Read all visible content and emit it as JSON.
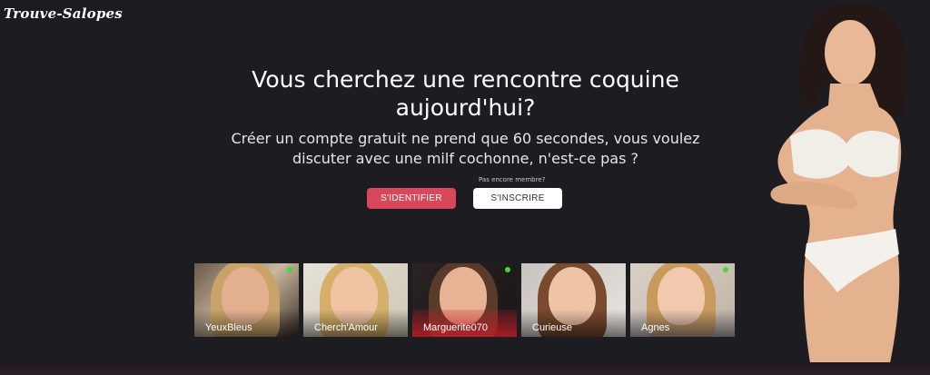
{
  "site": {
    "logo": "Trouve-Salopes"
  },
  "hero": {
    "headline": "Vous cherchez une rencontre coquine aujourd'hui?",
    "subline": "Créer un compte gratuit ne prend que 60 secondes, vous voulez discuter avec une milf cochonne, n'est-ce pas ?",
    "not_member": "Pas encore membre?",
    "login_label": "S'IDENTIFIER",
    "signup_label": "S'INSCRIRE"
  },
  "profiles": [
    {
      "name": "YeuxBleus",
      "online": true
    },
    {
      "name": "Cherch'Amour",
      "online": false
    },
    {
      "name": "Marguerite070",
      "online": true
    },
    {
      "name": "Curieuse",
      "online": false
    },
    {
      "name": "Agnes",
      "online": true
    }
  ],
  "colors": {
    "background": "#1d1c21",
    "accent": "#d8485a",
    "online": "#3ddc3d"
  }
}
